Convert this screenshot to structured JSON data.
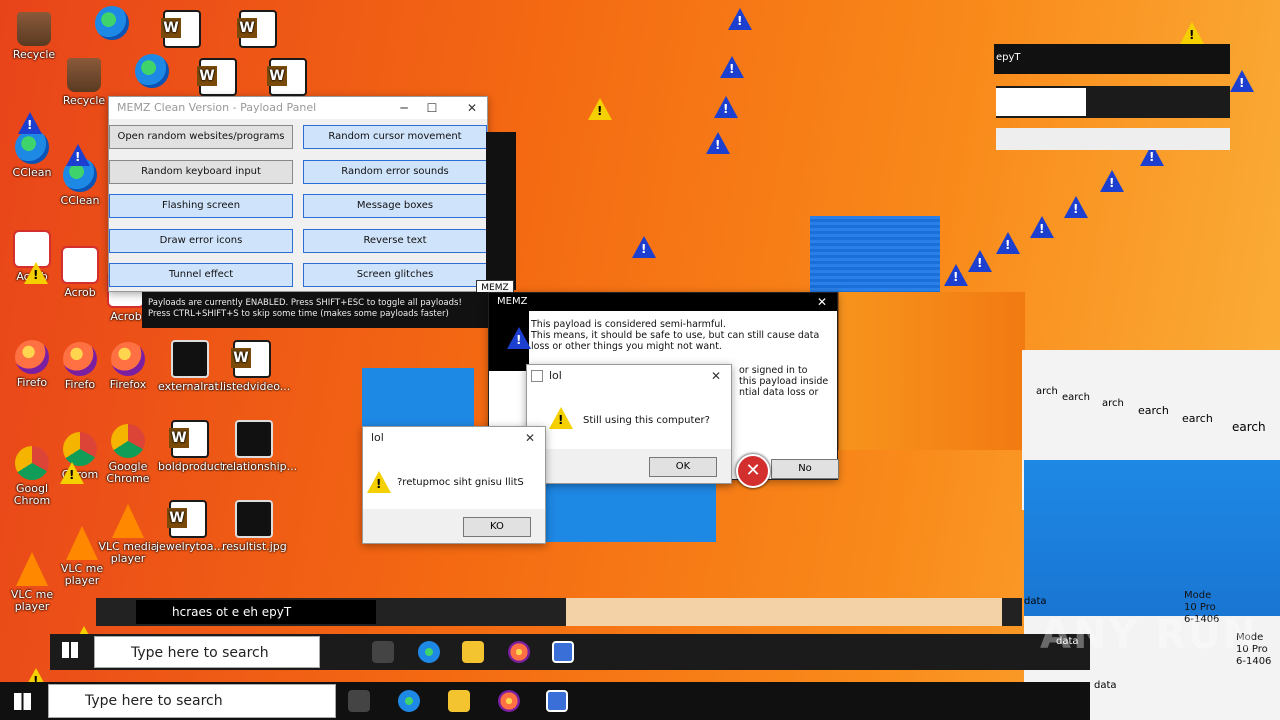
{
  "desktop": {
    "icons": [
      {
        "label": "Recycle",
        "kind": "recycle"
      },
      {
        "label": "Recycle",
        "kind": "recycle"
      },
      {
        "label": "CClean",
        "kind": "edgeapp"
      },
      {
        "label": "CClean",
        "kind": "edgeapp"
      },
      {
        "label": "Acrob",
        "kind": "acrobat"
      },
      {
        "label": "Acrob",
        "kind": "acrobat"
      },
      {
        "label": "Acrob",
        "kind": "acrobat"
      },
      {
        "label": "Firefo",
        "kind": "firefox"
      },
      {
        "label": "Firefo",
        "kind": "firefox"
      },
      {
        "label": "Firefox",
        "kind": "firefox"
      },
      {
        "label": "Googl Chrom",
        "kind": "chrome"
      },
      {
        "label": "Chrom",
        "kind": "chrome"
      },
      {
        "label": "Google Chrome",
        "kind": "chrome"
      },
      {
        "label": "VLC me player",
        "kind": "vlc"
      },
      {
        "label": "VLC me player",
        "kind": "vlc"
      },
      {
        "label": "VLC media player",
        "kind": "vlc"
      },
      {
        "label": "externalrat...",
        "kind": "jpg"
      },
      {
        "label": "listedvideo...",
        "kind": "word"
      },
      {
        "label": "boldproduct...",
        "kind": "word"
      },
      {
        "label": "relationship...",
        "kind": "jpg"
      },
      {
        "label": "jewelrytoa...",
        "kind": "word"
      },
      {
        "label": "resultist.jpg",
        "kind": "jpg"
      }
    ]
  },
  "payload_panel": {
    "title": "MEMZ Clean Version - Payload Panel",
    "buttons": [
      "Open random websites/programs",
      "Random cursor movement",
      "Random keyboard input",
      "Random error sounds",
      "Flashing screen",
      "Message boxes",
      "Draw error icons",
      "Reverse text",
      "Tunnel effect",
      "Screen glitches"
    ],
    "footer_line1": "Payloads are currently ENABLED. Press SHIFT+ESC to toggle all payloads!",
    "footer_line2": "Press CTRL+SHIFT+S to skip some time (makes some payloads faster)",
    "memz_label": "MEMZ"
  },
  "memz_dialog": {
    "title": "MEMZ",
    "line1": "This payload is considered semi-harmful.",
    "line2": "This means, it should be safe to use, but can still cause data",
    "line3": "loss or other things you might not want.",
    "line4": "or signed in to",
    "line5": "this payload inside",
    "line6": "ntial data loss or",
    "no_label": "No"
  },
  "lol_dialog_1": {
    "title": "lol",
    "message": "Still using this computer?",
    "ok_label": "OK"
  },
  "lol_dialog_2": {
    "title": "lol",
    "message": "?retupmoc siht gnisu llitS",
    "ok_label": "KO"
  },
  "glitch_windows": {
    "search_labels": [
      "arch",
      "earch",
      "arch",
      "earch",
      "earch",
      "earch"
    ],
    "data_labels": [
      "data",
      "data",
      "data"
    ],
    "mode_texts": [
      "Mode",
      "10 Pro",
      "6-1406",
      "Mode",
      "10 Pro",
      "6-1406"
    ],
    "reversed_search": "hcraes ot e eh epyT",
    "search_mirror": "epyT"
  },
  "taskbar": {
    "search_placeholder_1": "Type here to search",
    "search_placeholder_2": "Type here to search"
  },
  "watermark": "ANY RUN",
  "colors": {
    "accent_blue": "#2b6fd6",
    "warning_blue": "#1d3fd0",
    "warning_yellow": "#f5d000",
    "error_red": "#d32f2f"
  }
}
